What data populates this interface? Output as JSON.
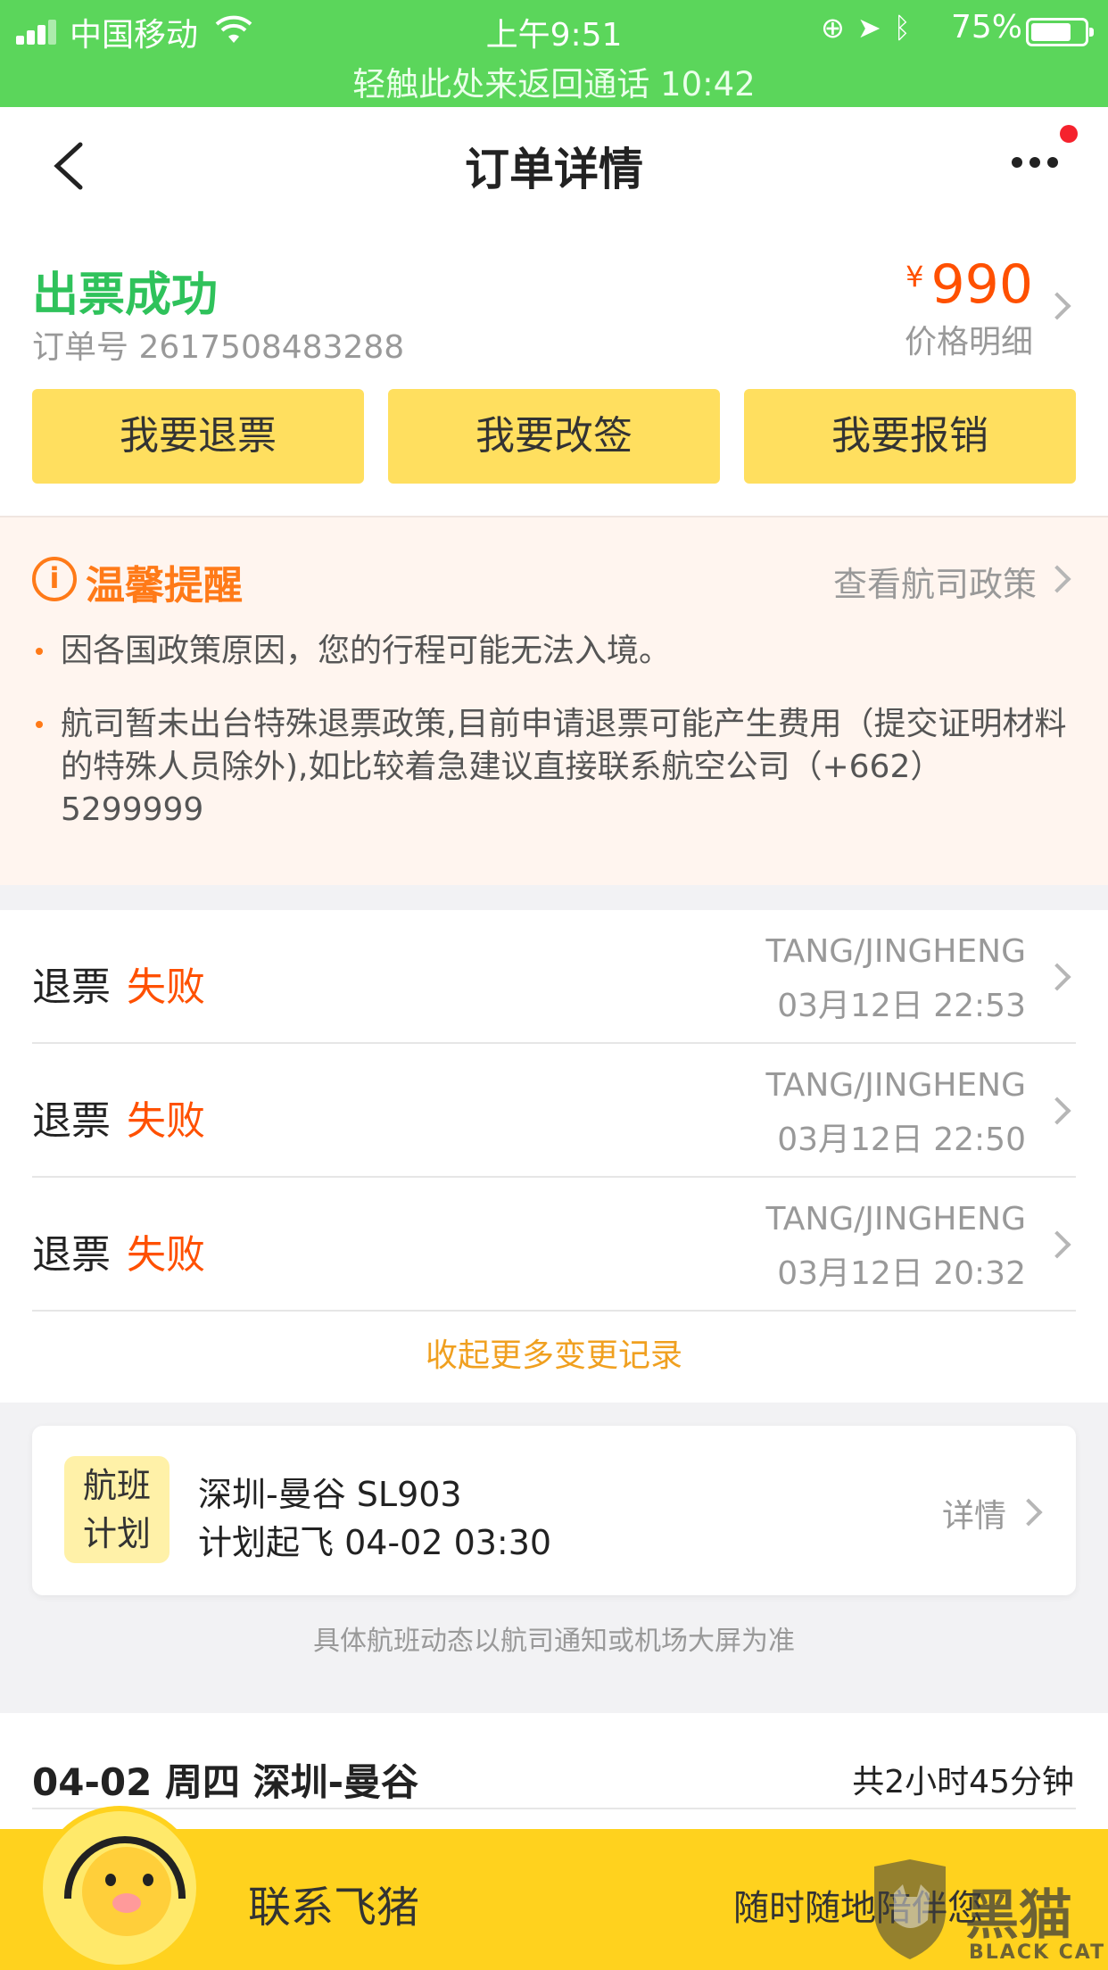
{
  "status_bar": {
    "carrier": "中国移动",
    "time": "上午9:51",
    "battery": "75%",
    "call_banner": "轻触此处来返回通话 10:42"
  },
  "nav": {
    "title": "订单详情"
  },
  "order": {
    "status": "出票成功",
    "number": "订单号 2617508483288",
    "currency": "¥",
    "price": "990",
    "price_detail": "价格明细",
    "actions": [
      "我要退票",
      "我要改签",
      "我要报销"
    ]
  },
  "reminder": {
    "title": "温馨提醒",
    "policy_link": "查看航司政策",
    "items": [
      "因各国政策原因，您的行程可能无法入境。",
      "航司暂未出台特殊退票政策,目前申请退票可能产生费用（提交证明材料的特殊人员除外),如比较着急建议直接联系航空公司（+662）5299999"
    ]
  },
  "records": {
    "items": [
      {
        "type": "退票",
        "status": "失败",
        "name": "TANG/JINGHENG",
        "time": "03月12日 22:53"
      },
      {
        "type": "退票",
        "status": "失败",
        "name": "TANG/JINGHENG",
        "time": "03月12日 22:50"
      },
      {
        "type": "退票",
        "status": "失败",
        "name": "TANG/JINGHENG",
        "time": "03月12日 20:32"
      }
    ],
    "collapse_label": "收起更多变更记录"
  },
  "flight": {
    "badge_line1": "航班",
    "badge_line2": "计划",
    "route": "深圳-曼谷 SL903",
    "plan": "计划起飞 04-02 03:30",
    "detail": "详情",
    "note": "具体航班动态以航司通知或机场大屏为准"
  },
  "itinerary": {
    "date": "04-02 周四 深圳-曼谷",
    "duration": "共2小时45分钟"
  },
  "bottom": {
    "contact": "联系飞猪",
    "subtitle": "随时随地陪伴您",
    "watermark": "黑猫",
    "watermark_sub": "BLACK CAT"
  },
  "colors": {
    "status_bar": "#5bd65b",
    "success": "#2fc25b",
    "price": "#ff5000",
    "button": "#ffdf5f",
    "reminder_accent": "#ff7a18",
    "bottom_bar": "#ffd21e"
  }
}
